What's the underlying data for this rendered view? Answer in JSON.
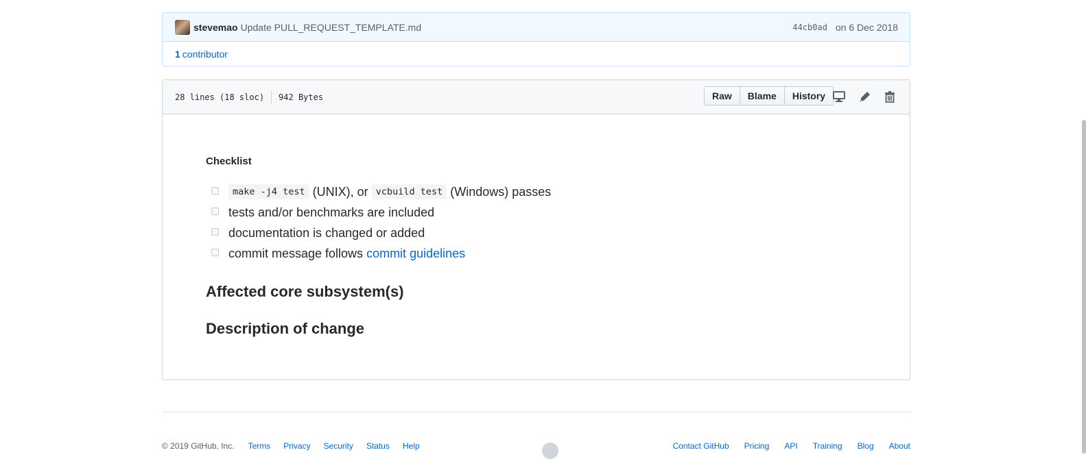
{
  "commit": {
    "author": "stevemao",
    "message": "Update PULL_REQUEST_TEMPLATE.md",
    "sha": "44cb0ad",
    "date": "on 6 Dec 2018",
    "contributors_count": "1",
    "contributors_label": "contributor"
  },
  "file": {
    "lines": "28 lines (18 sloc)",
    "size": "942 Bytes",
    "buttons": {
      "raw": "Raw",
      "blame": "Blame",
      "history": "History"
    },
    "icons": [
      "desktop-icon",
      "pencil-icon",
      "trash-icon"
    ]
  },
  "content": {
    "checklist_heading": "Checklist",
    "tasks": [
      {
        "code1": "make -j4 test",
        "text1": " (UNIX), or ",
        "code2": "vcbuild test",
        "text2": " (Windows) passes"
      },
      {
        "text": "tests and/or benchmarks are included"
      },
      {
        "text": "documentation is changed or added"
      },
      {
        "text": "commit message follows ",
        "link": "commit guidelines"
      }
    ],
    "heading_affected": "Affected core subsystem(s)",
    "heading_description": "Description of change"
  },
  "footer": {
    "copyright": "© 2019 GitHub, Inc.",
    "left_links": [
      "Terms",
      "Privacy",
      "Security",
      "Status",
      "Help"
    ],
    "right_links": [
      "Contact GitHub",
      "Pricing",
      "API",
      "Training",
      "Blog",
      "About"
    ]
  }
}
